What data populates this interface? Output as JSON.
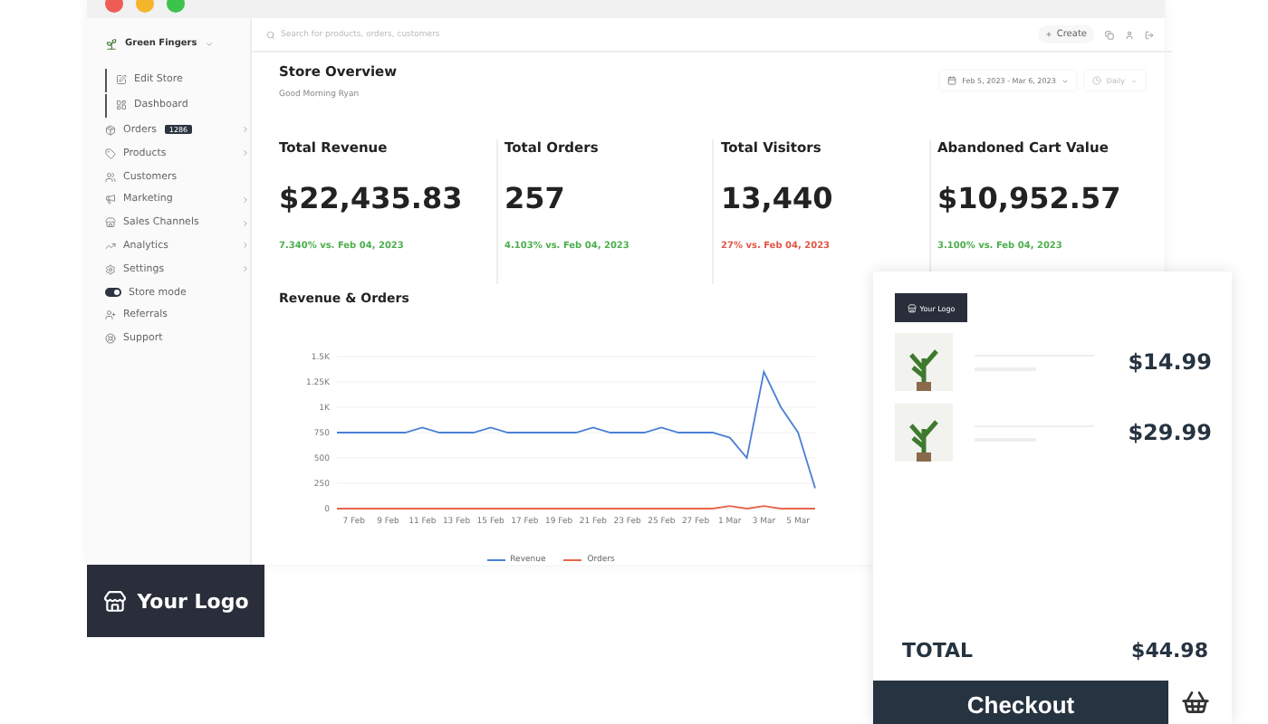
{
  "store": {
    "name": "Green Fingers"
  },
  "sidebar": {
    "items": [
      {
        "kind": "subitem",
        "label": "Edit Store"
      },
      {
        "kind": "subitem",
        "label": "Dashboard"
      },
      {
        "kind": "link",
        "label": "Orders",
        "badge": "1286",
        "has_submenu": true
      },
      {
        "kind": "link",
        "label": "Products",
        "has_submenu": true
      },
      {
        "kind": "link",
        "label": "Customers",
        "has_submenu": false
      },
      {
        "kind": "link",
        "label": "Marketing",
        "has_submenu": true
      },
      {
        "kind": "link",
        "label": "Sales Channels",
        "has_submenu": true
      },
      {
        "kind": "link",
        "label": "Analytics",
        "has_submenu": true
      },
      {
        "kind": "link",
        "label": "Settings",
        "has_submenu": true
      },
      {
        "kind": "toggle",
        "label": "Store mode",
        "on": true
      },
      {
        "kind": "link",
        "label": "Referrals",
        "has_submenu": false
      },
      {
        "kind": "link",
        "label": "Support",
        "has_submenu": false
      }
    ]
  },
  "search": {
    "placeholder": "Search for products, orders, customers"
  },
  "topbar": {
    "create_label": "Create"
  },
  "overview": {
    "title": "Store Overview",
    "greeting": "Good Morning Ryan",
    "date_range": "Feb 5, 2023 - Mar 6, 2023",
    "interval": "Daily"
  },
  "stats": [
    {
      "title": "Total Revenue",
      "value": "$22,435.83",
      "change": "7.340% vs. Feb 04, 2023",
      "color": "#4cae4c"
    },
    {
      "title": "Total Orders",
      "value": "257",
      "change": "4.103% vs. Feb 04, 2023",
      "color": "#4cae4c"
    },
    {
      "title": "Total Visitors",
      "value": "13,440",
      "change": "27% vs. Feb 04, 2023",
      "color": "#e05545"
    },
    {
      "title": "Abandoned Cart Value",
      "value": "$10,952.57",
      "change": "3.100% vs. Feb 04, 2023",
      "color": "#4cae4c"
    }
  ],
  "revenue_panel": {
    "title": "Revenue & Orders",
    "chart_data": {
      "type": "line",
      "categories": [
        null,
        "7 Feb",
        null,
        "9 Feb",
        null,
        "11 Feb",
        null,
        "13 Feb",
        null,
        "15 Feb",
        null,
        "17 Feb",
        null,
        "19 Feb",
        null,
        "21 Feb",
        null,
        "23 Feb",
        null,
        "25 Feb",
        null,
        "27 Feb",
        null,
        "1 Mar",
        null,
        "3 Mar",
        null,
        "5 Mar",
        null
      ],
      "series": [
        {
          "name": "Revenue",
          "color": "#4a7fd4",
          "values": [
            750,
            750,
            750,
            750,
            750,
            800,
            750,
            750,
            750,
            800,
            750,
            750,
            750,
            750,
            750,
            800,
            750,
            750,
            750,
            800,
            750,
            750,
            750,
            700,
            500,
            1350,
            1000,
            750,
            200
          ]
        },
        {
          "name": "Orders",
          "color": "#e8654a",
          "values": [
            0,
            0,
            0,
            0,
            0,
            0,
            0,
            0,
            0,
            0,
            0,
            0,
            0,
            0,
            0,
            0,
            0,
            0,
            0,
            0,
            0,
            0,
            0,
            25,
            0,
            25,
            0,
            0,
            0
          ]
        }
      ],
      "ylim": [
        0,
        1500
      ],
      "grid": true,
      "yticks": [
        0,
        250,
        500,
        750,
        {
          "value": 1000,
          "label": "1K"
        },
        {
          "value": 1250,
          "label": "1.25K"
        },
        {
          "value": 1500,
          "label": "1.5K"
        }
      ]
    }
  },
  "footer_logo": {
    "label": "Your Logo"
  },
  "cart": {
    "logo_label": "Your Logo",
    "items": [
      {
        "price": "$14.99"
      },
      {
        "price": "$29.99"
      }
    ],
    "total_label": "TOTAL",
    "total": "$44.98",
    "checkout_label": "Checkout"
  }
}
